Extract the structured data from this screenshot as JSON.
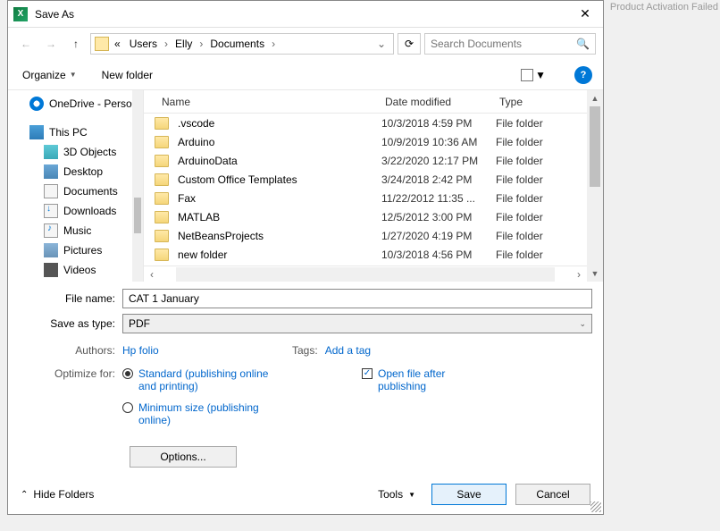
{
  "bg_status": "Product Activation Failed",
  "titlebar": {
    "title": "Save As"
  },
  "nav": {
    "crumbs_prefix": "«",
    "crumbs": [
      "Users",
      "Elly",
      "Documents"
    ],
    "search_placeholder": "Search Documents"
  },
  "toolbar": {
    "organize": "Organize",
    "new_folder": "New folder"
  },
  "sidebar": {
    "items": [
      {
        "label": "OneDrive - Person",
        "icon": "cloud"
      },
      {
        "label": "This PC",
        "icon": "pc"
      },
      {
        "label": "3D Objects",
        "icon": "3d",
        "child": true
      },
      {
        "label": "Desktop",
        "icon": "desktop",
        "child": true
      },
      {
        "label": "Documents",
        "icon": "doc",
        "child": true
      },
      {
        "label": "Downloads",
        "icon": "dl",
        "child": true
      },
      {
        "label": "Music",
        "icon": "music",
        "child": true
      },
      {
        "label": "Pictures",
        "icon": "pic",
        "child": true
      },
      {
        "label": "Videos",
        "icon": "vid",
        "child": true
      }
    ]
  },
  "columns": {
    "name": "Name",
    "date": "Date modified",
    "type": "Type"
  },
  "files": [
    {
      "name": ".vscode",
      "date": "10/3/2018 4:59 PM",
      "type": "File folder"
    },
    {
      "name": "Arduino",
      "date": "10/9/2019 10:36 AM",
      "type": "File folder"
    },
    {
      "name": "ArduinoData",
      "date": "3/22/2020 12:17 PM",
      "type": "File folder"
    },
    {
      "name": "Custom Office Templates",
      "date": "3/24/2018 2:42 PM",
      "type": "File folder"
    },
    {
      "name": "Fax",
      "date": "11/22/2012 11:35 ...",
      "type": "File folder"
    },
    {
      "name": "MATLAB",
      "date": "12/5/2012 3:00 PM",
      "type": "File folder"
    },
    {
      "name": "NetBeansProjects",
      "date": "1/27/2020 4:19 PM",
      "type": "File folder"
    },
    {
      "name": "new folder",
      "date": "10/3/2018 4:56 PM",
      "type": "File folder"
    }
  ],
  "fields": {
    "filename_label": "File name:",
    "filename_value": "CAT 1 January",
    "saveastype_label": "Save as type:",
    "saveastype_value": "PDF"
  },
  "meta": {
    "authors_label": "Authors:",
    "authors_value": "Hp folio",
    "tags_label": "Tags:",
    "tags_value": "Add a tag"
  },
  "optimize": {
    "label": "Optimize for:",
    "standard": "Standard (publishing online and printing)",
    "minimum": "Minimum size (publishing online)",
    "options_btn": "Options...",
    "open_after": "Open file after publishing"
  },
  "footer": {
    "hide_folders": "Hide Folders",
    "tools": "Tools",
    "save": "Save",
    "cancel": "Cancel"
  }
}
